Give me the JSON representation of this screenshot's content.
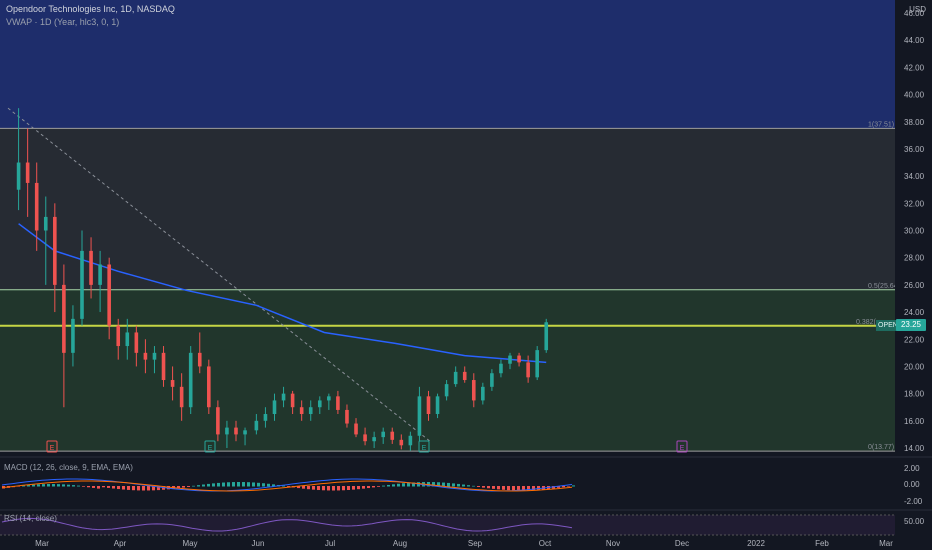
{
  "header": {
    "title": "Opendoor Technologies Inc, 1D, NASDAQ",
    "indicator": "VWAP · 1D (Year, hlc3, 0, 1)",
    "currency": "USD"
  },
  "price_axis": {
    "labels": [
      "46.00",
      "44.00",
      "42.00",
      "40.00",
      "38.00",
      "36.00",
      "34.00",
      "32.00",
      "30.00",
      "28.00",
      "26.00",
      "24.00",
      "22.00",
      "20.00",
      "18.00",
      "16.00",
      "14.00"
    ]
  },
  "time_axis": {
    "labels": [
      "Mar",
      "Apr",
      "May",
      "Jun",
      "Jul",
      "Aug",
      "Sep",
      "Oct",
      "Nov",
      "Dec",
      "2022",
      "Feb",
      "Mar"
    ]
  },
  "fib_levels": {
    "level_1": "1(37.51)",
    "level_05": "0.5(25.64)",
    "level_0382": "0.382(",
    "level_0": "0(13.77)"
  },
  "last_price": {
    "ticker": "OPEN",
    "value": "23.25"
  },
  "macd": {
    "label": "MACD (12, 26, close, 9, EMA, EMA)",
    "axis": [
      "2.00",
      "0.00",
      "-2.00"
    ]
  },
  "rsi": {
    "label": "RSI (14, close)",
    "axis": [
      "50.00"
    ]
  },
  "event_markers": [
    "E",
    "E",
    "E",
    "E"
  ],
  "colors": {
    "background": "#131722",
    "upper_band": "#1e2d6b",
    "mid_band": "#262b33",
    "lower_band": "#243a2e",
    "up_candle": "#26a69a",
    "down_candle": "#ef5350",
    "vwap": "#2962ff",
    "fib_line": "#a5d6a7",
    "highlight_line": "#c6d544",
    "macd_line": "#2962ff",
    "signal_line": "#ff6d00",
    "rsi_line": "#7e57c2"
  },
  "chart_data": {
    "type": "candlestick",
    "note_series": "daily OHLC, Feb–Oct 2021",
    "series": [
      {
        "date": "2021-02-16",
        "o": 33.0,
        "h": 39.0,
        "l": 31.5,
        "c": 35.0
      },
      {
        "date": "2021-02-20",
        "o": 35.0,
        "h": 37.5,
        "l": 31.0,
        "c": 33.5
      },
      {
        "date": "2021-02-24",
        "o": 33.5,
        "h": 35.0,
        "l": 28.5,
        "c": 30.0
      },
      {
        "date": "2021-02-28",
        "o": 30.0,
        "h": 32.5,
        "l": 26.0,
        "c": 31.0
      },
      {
        "date": "2021-03-04",
        "o": 31.0,
        "h": 32.0,
        "l": 24.0,
        "c": 26.0
      },
      {
        "date": "2021-03-08",
        "o": 26.0,
        "h": 27.5,
        "l": 17.0,
        "c": 21.0
      },
      {
        "date": "2021-03-12",
        "o": 21.0,
        "h": 24.5,
        "l": 20.0,
        "c": 23.5
      },
      {
        "date": "2021-03-16",
        "o": 23.5,
        "h": 30.0,
        "l": 23.0,
        "c": 28.5
      },
      {
        "date": "2021-03-20",
        "o": 28.5,
        "h": 29.5,
        "l": 25.0,
        "c": 26.0
      },
      {
        "date": "2021-03-24",
        "o": 26.0,
        "h": 28.5,
        "l": 24.0,
        "c": 27.5
      },
      {
        "date": "2021-03-28",
        "o": 27.5,
        "h": 28.0,
        "l": 22.0,
        "c": 23.0
      },
      {
        "date": "2021-04-01",
        "o": 23.0,
        "h": 23.5,
        "l": 20.5,
        "c": 21.5
      },
      {
        "date": "2021-04-05",
        "o": 21.5,
        "h": 23.5,
        "l": 20.5,
        "c": 22.5
      },
      {
        "date": "2021-04-09",
        "o": 22.5,
        "h": 23.0,
        "l": 20.0,
        "c": 21.0
      },
      {
        "date": "2021-04-13",
        "o": 21.0,
        "h": 22.0,
        "l": 19.5,
        "c": 20.5
      },
      {
        "date": "2021-04-17",
        "o": 20.5,
        "h": 21.5,
        "l": 19.5,
        "c": 21.0
      },
      {
        "date": "2021-04-21",
        "o": 21.0,
        "h": 21.5,
        "l": 18.5,
        "c": 19.0
      },
      {
        "date": "2021-04-25",
        "o": 19.0,
        "h": 20.0,
        "l": 17.5,
        "c": 18.5
      },
      {
        "date": "2021-04-29",
        "o": 18.5,
        "h": 19.5,
        "l": 16.0,
        "c": 17.0
      },
      {
        "date": "2021-05-03",
        "o": 17.0,
        "h": 21.5,
        "l": 16.5,
        "c": 21.0
      },
      {
        "date": "2021-05-07",
        "o": 21.0,
        "h": 22.5,
        "l": 19.5,
        "c": 20.0
      },
      {
        "date": "2021-05-11",
        "o": 20.0,
        "h": 20.5,
        "l": 16.5,
        "c": 17.0
      },
      {
        "date": "2021-05-15",
        "o": 17.0,
        "h": 17.5,
        "l": 14.5,
        "c": 15.0
      },
      {
        "date": "2021-05-19",
        "o": 15.0,
        "h": 16.0,
        "l": 14.0,
        "c": 15.5
      },
      {
        "date": "2021-05-23",
        "o": 15.5,
        "h": 16.0,
        "l": 14.5,
        "c": 15.0
      },
      {
        "date": "2021-05-27",
        "o": 15.0,
        "h": 15.5,
        "l": 14.2,
        "c": 15.3
      },
      {
        "date": "2021-06-01",
        "o": 15.3,
        "h": 16.5,
        "l": 15.0,
        "c": 16.0
      },
      {
        "date": "2021-06-05",
        "o": 16.0,
        "h": 17.0,
        "l": 15.5,
        "c": 16.5
      },
      {
        "date": "2021-06-09",
        "o": 16.5,
        "h": 18.0,
        "l": 16.0,
        "c": 17.5
      },
      {
        "date": "2021-06-13",
        "o": 17.5,
        "h": 18.5,
        "l": 17.0,
        "c": 18.0
      },
      {
        "date": "2021-06-17",
        "o": 18.0,
        "h": 18.2,
        "l": 16.5,
        "c": 17.0
      },
      {
        "date": "2021-06-21",
        "o": 17.0,
        "h": 17.5,
        "l": 16.0,
        "c": 16.5
      },
      {
        "date": "2021-06-25",
        "o": 16.5,
        "h": 17.5,
        "l": 16.0,
        "c": 17.0
      },
      {
        "date": "2021-06-29",
        "o": 17.0,
        "h": 17.8,
        "l": 16.5,
        "c": 17.5
      },
      {
        "date": "2021-07-03",
        "o": 17.5,
        "h": 18.0,
        "l": 16.8,
        "c": 17.8
      },
      {
        "date": "2021-07-07",
        "o": 17.8,
        "h": 18.2,
        "l": 16.5,
        "c": 16.8
      },
      {
        "date": "2021-07-11",
        "o": 16.8,
        "h": 17.2,
        "l": 15.5,
        "c": 15.8
      },
      {
        "date": "2021-07-15",
        "o": 15.8,
        "h": 16.2,
        "l": 14.8,
        "c": 15.0
      },
      {
        "date": "2021-07-19",
        "o": 15.0,
        "h": 15.5,
        "l": 14.2,
        "c": 14.5
      },
      {
        "date": "2021-07-23",
        "o": 14.5,
        "h": 15.2,
        "l": 14.0,
        "c": 14.8
      },
      {
        "date": "2021-07-27",
        "o": 14.8,
        "h": 15.5,
        "l": 14.3,
        "c": 15.2
      },
      {
        "date": "2021-07-31",
        "o": 15.2,
        "h": 15.5,
        "l": 14.3,
        "c": 14.6
      },
      {
        "date": "2021-08-04",
        "o": 14.6,
        "h": 15.0,
        "l": 13.9,
        "c": 14.2
      },
      {
        "date": "2021-08-08",
        "o": 14.2,
        "h": 15.2,
        "l": 13.8,
        "c": 14.9
      },
      {
        "date": "2021-08-12",
        "o": 14.9,
        "h": 18.5,
        "l": 14.5,
        "c": 17.8
      },
      {
        "date": "2021-08-16",
        "o": 17.8,
        "h": 18.2,
        "l": 16.0,
        "c": 16.5
      },
      {
        "date": "2021-08-20",
        "o": 16.5,
        "h": 18.0,
        "l": 16.2,
        "c": 17.8
      },
      {
        "date": "2021-08-24",
        "o": 17.8,
        "h": 19.0,
        "l": 17.5,
        "c": 18.7
      },
      {
        "date": "2021-08-28",
        "o": 18.7,
        "h": 20.0,
        "l": 18.5,
        "c": 19.6
      },
      {
        "date": "2021-09-01",
        "o": 19.6,
        "h": 20.0,
        "l": 18.8,
        "c": 19.0
      },
      {
        "date": "2021-09-05",
        "o": 19.0,
        "h": 19.5,
        "l": 17.0,
        "c": 17.5
      },
      {
        "date": "2021-09-09",
        "o": 17.5,
        "h": 18.8,
        "l": 17.2,
        "c": 18.5
      },
      {
        "date": "2021-09-13",
        "o": 18.5,
        "h": 19.8,
        "l": 18.2,
        "c": 19.5
      },
      {
        "date": "2021-09-17",
        "o": 19.5,
        "h": 20.5,
        "l": 19.2,
        "c": 20.2
      },
      {
        "date": "2021-09-21",
        "o": 20.2,
        "h": 21.0,
        "l": 19.8,
        "c": 20.8
      },
      {
        "date": "2021-09-25",
        "o": 20.8,
        "h": 21.0,
        "l": 20.0,
        "c": 20.3
      },
      {
        "date": "2021-09-29",
        "o": 20.3,
        "h": 20.8,
        "l": 18.8,
        "c": 19.2
      },
      {
        "date": "2021-10-03",
        "o": 19.2,
        "h": 21.5,
        "l": 19.0,
        "c": 21.2
      },
      {
        "date": "2021-10-07",
        "o": 21.2,
        "h": 23.5,
        "l": 21.0,
        "c": 23.25
      }
    ],
    "vwap": [
      {
        "date": "2021-02-16",
        "v": 30.5
      },
      {
        "date": "2021-03-04",
        "v": 28.5
      },
      {
        "date": "2021-04-01",
        "v": 27.0
      },
      {
        "date": "2021-05-01",
        "v": 25.6
      },
      {
        "date": "2021-06-01",
        "v": 24.5
      },
      {
        "date": "2021-07-01",
        "v": 22.5
      },
      {
        "date": "2021-08-01",
        "v": 21.7
      },
      {
        "date": "2021-09-01",
        "v": 20.8
      },
      {
        "date": "2021-10-07",
        "v": 20.3
      }
    ],
    "ylim": [
      13.0,
      47.0
    ],
    "xlim": [
      "2021-02-10",
      "2022-03-10"
    ]
  }
}
